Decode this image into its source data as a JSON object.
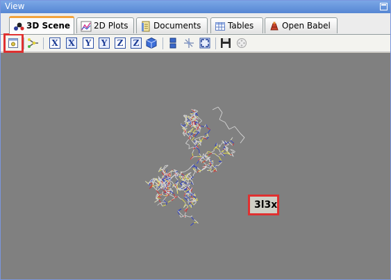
{
  "window": {
    "title": "View"
  },
  "tabs": [
    {
      "label": "3D Scene",
      "active": true,
      "icon": "molecule-icon"
    },
    {
      "label": "2D Plots",
      "active": false,
      "icon": "chart-icon"
    },
    {
      "label": "Documents",
      "active": false,
      "icon": "document-icon"
    },
    {
      "label": "Tables",
      "active": false,
      "icon": "table-icon"
    },
    {
      "label": "Open Babel",
      "active": false,
      "icon": "babel-icon"
    }
  ],
  "toolbar": {
    "axis_buttons": [
      "X",
      "X",
      "Y",
      "Y",
      "Z",
      "Z"
    ]
  },
  "scene": {
    "pdb_label": "3l3x",
    "background": "#808080",
    "highlight_color": "#e03030"
  }
}
